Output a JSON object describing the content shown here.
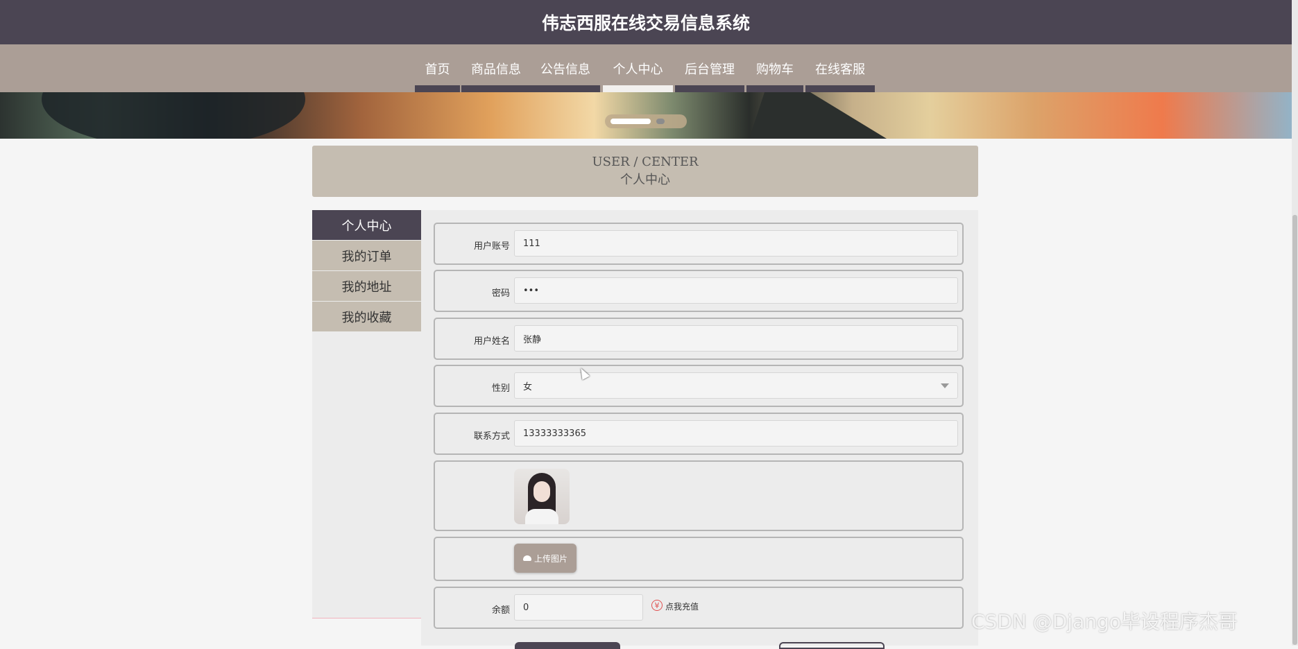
{
  "site": {
    "title": "伟志西服在线交易信息系统"
  },
  "nav": {
    "items": [
      {
        "label": "首页"
      },
      {
        "label": "商品信息"
      },
      {
        "label": "公告信息"
      },
      {
        "label": "个人中心",
        "active": true
      },
      {
        "label": "后台管理"
      },
      {
        "label": "购物车"
      },
      {
        "label": "在线客服"
      }
    ]
  },
  "section": {
    "title_en": "USER / CENTER",
    "title_cn": "个人中心"
  },
  "sidebar": {
    "items": [
      {
        "label": "个人中心",
        "active": true
      },
      {
        "label": "我的订单"
      },
      {
        "label": "我的地址"
      },
      {
        "label": "我的收藏"
      }
    ]
  },
  "form": {
    "account": {
      "label": "用户账号",
      "value": "111"
    },
    "password": {
      "label": "密码",
      "value": "•••"
    },
    "name": {
      "label": "用户姓名",
      "value": "张静"
    },
    "gender": {
      "label": "性别",
      "value": "女"
    },
    "phone": {
      "label": "联系方式",
      "value": "13333333365"
    },
    "upload": {
      "label": "上传图片"
    },
    "balance": {
      "label": "余额",
      "value": "0",
      "recharge_label": "点我充值",
      "recharge_symbol": "¥"
    }
  },
  "watermark": {
    "text": "CSDN @Django毕设程序杰哥"
  },
  "colors": {
    "header_bg": "#4b4553",
    "nav_bg": "#ab9e96",
    "section_bg": "#c5bdb1"
  }
}
